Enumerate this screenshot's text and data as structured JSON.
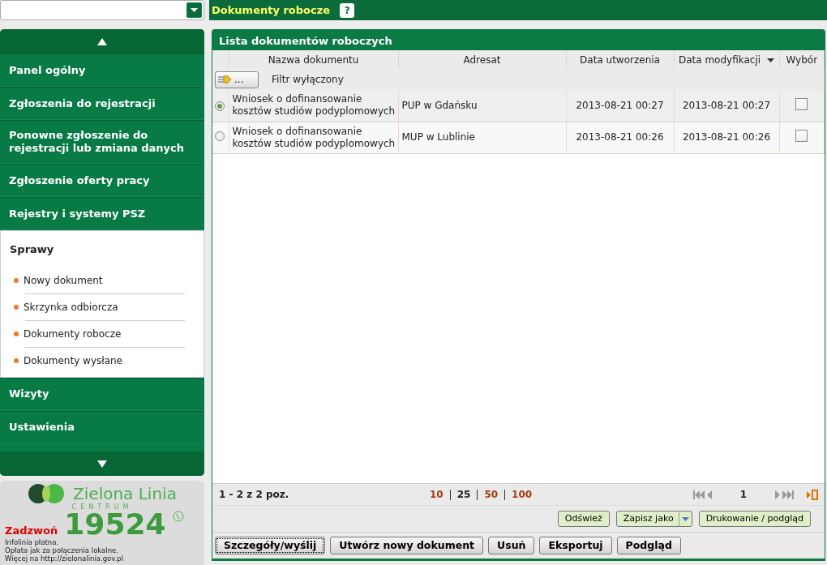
{
  "header": {
    "title": "Dokumenty robocze",
    "help": "?"
  },
  "sidebar": {
    "items": [
      {
        "label": "Panel ogólny",
        "expanded": false
      },
      {
        "label": "Zgłoszenia do rejestracji",
        "expanded": false
      },
      {
        "label": "Ponowne zgłoszenie do rejestracji lub zmiana danych",
        "expanded": false
      },
      {
        "label": "Zgłoszenie oferty pracy",
        "expanded": false
      },
      {
        "label": "Rejestry i systemy PSZ",
        "expanded": false
      },
      {
        "label": "Sprawy",
        "expanded": true,
        "children": [
          {
            "label": "Nowy dokument"
          },
          {
            "label": "Skrzynka odbiorcza"
          },
          {
            "label": "Dokumenty robocze"
          },
          {
            "label": "Dokumenty wysłane"
          }
        ]
      },
      {
        "label": "Wizyty",
        "expanded": false
      },
      {
        "label": "Ustawienia",
        "expanded": false
      }
    ]
  },
  "promo": {
    "brand": "Zielona Linia",
    "sub": "CENTRUM",
    "call": "Zadzwoń",
    "number": "19524",
    "lines": [
      "Infolinia płatna.",
      "Opłata jak za połączenia lokalne.",
      "Więcej na http://zielonalinia.gov.pl"
    ]
  },
  "panel": {
    "title": "Lista dokumentów roboczych",
    "columns": [
      {
        "label": "Nazwa dokumentu",
        "sorted": false
      },
      {
        "label": "Adresat",
        "sorted": false
      },
      {
        "label": "Data utworzenia",
        "sorted": false
      },
      {
        "label": "Data modyfikacji",
        "sorted": true
      },
      {
        "label": "Wybór",
        "sorted": false
      }
    ],
    "filter": {
      "button": "...",
      "label": "Filtr wyłączony"
    },
    "rows": [
      {
        "selected": true,
        "name": "Wniosek o dofinansowanie kosztów studiów podyplomowych",
        "addressee": "PUP w Gdańsku",
        "created": "2013-08-21 00:27",
        "modified": "2013-08-21 00:27",
        "checked": false
      },
      {
        "selected": false,
        "name": "Wniosek o dofinansowanie kosztów studiów podyplomowych",
        "addressee": "MUP w Lublinie",
        "created": "2013-08-21 00:26",
        "modified": "2013-08-21 00:26",
        "checked": false
      }
    ],
    "pager": {
      "info": "1 - 2 z 2 poz.",
      "sizes": [
        {
          "label": "10",
          "selected": false
        },
        {
          "label": "25",
          "selected": true
        },
        {
          "label": "50",
          "selected": false
        },
        {
          "label": "100",
          "selected": false
        }
      ],
      "page": "1"
    },
    "actions": [
      {
        "label": "Odśwież",
        "kind": "plain"
      },
      {
        "label": "Zapisz jako",
        "kind": "split"
      },
      {
        "label": "Drukowanie / podgląd",
        "kind": "plain"
      }
    ],
    "buttons": [
      {
        "label": "Szczegóły/wyślij",
        "focused": true
      },
      {
        "label": "Utwórz nowy dokument",
        "focused": false
      },
      {
        "label": "Usuń",
        "focused": false
      },
      {
        "label": "Eksportuj",
        "focused": false
      },
      {
        "label": "Podgląd",
        "focused": false
      }
    ]
  }
}
